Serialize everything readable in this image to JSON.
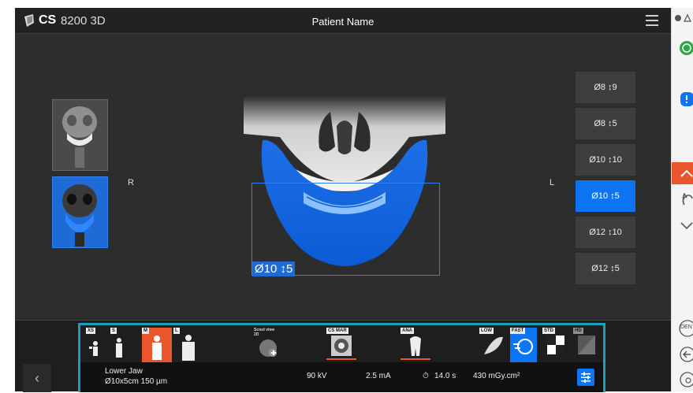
{
  "titlebar": {
    "brand": "CS",
    "model": "8200 3D",
    "patient_title": "Patient Name"
  },
  "view": {
    "left_label": "R",
    "right_label": "L",
    "roi_label": "Ø10 ↕5"
  },
  "fov_options": [
    {
      "label": "Ø8 ↕9",
      "selected": false
    },
    {
      "label": "Ø8 ↕5",
      "selected": false
    },
    {
      "label": "Ø10 ↕10",
      "selected": false
    },
    {
      "label": "Ø10 ↕5",
      "selected": true
    },
    {
      "label": "Ø12 ↕10",
      "selected": false
    },
    {
      "label": "Ø12 ↕5",
      "selected": false
    }
  ],
  "patient_size": {
    "labels": [
      "XS",
      "S",
      "M",
      "L"
    ],
    "selected": "M"
  },
  "scout_view": {
    "label": "Scout view 2D"
  },
  "cs_mar": {
    "label": "CS MAR"
  },
  "ana": {
    "label": "ANA"
  },
  "resolution": {
    "labels": [
      "LOW",
      "FAST",
      "STD",
      "HD"
    ],
    "selected": "FAST"
  },
  "info": {
    "region": "Lower Jaw",
    "fov": "Ø10x5cm 150 µm",
    "kv": "90 kV",
    "ma": "2.5 mA",
    "time": "14.0 s",
    "dose": "430 mGy.cm²"
  },
  "right_panel": {
    "dental_label": "DEN"
  },
  "colors": {
    "accent": "#0d74f3",
    "orange": "#e8562a",
    "teal": "#1aa0b8"
  }
}
